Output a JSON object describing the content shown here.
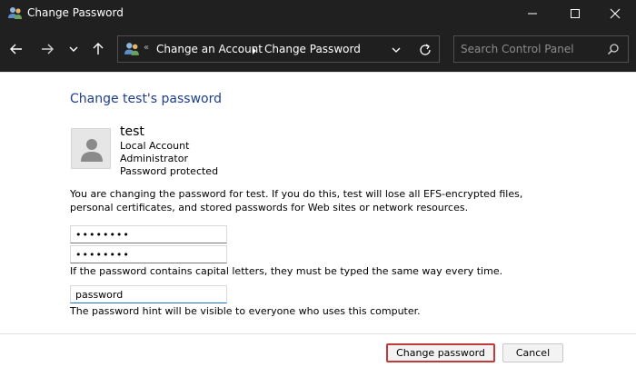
{
  "window": {
    "title": "Change Password"
  },
  "nav": {
    "breadcrumb_prefix": "«",
    "breadcrumb": [
      "Change an Account",
      "Change Password"
    ],
    "search_placeholder": "Search Control Panel"
  },
  "page": {
    "title": "Change test's password",
    "user": {
      "name": "test",
      "lines": [
        "Local Account",
        "Administrator",
        "Password protected"
      ]
    },
    "warning": "You are changing the password for test.  If you do this, test will lose all EFS-encrypted files, personal certificates, and stored passwords for Web sites or network resources.",
    "new_password_value": "••••••••",
    "confirm_password_value": "••••••••",
    "caps_note": "If the password contains capital letters, they must be typed the same way every time.",
    "hint_value": "password",
    "hint_note": "The password hint will be visible to everyone who uses this computer."
  },
  "buttons": {
    "change": "Change password",
    "cancel": "Cancel"
  },
  "colors": {
    "titlebar": "#202020",
    "title_blue": "#1e3f8a",
    "primary_border": "#c23a3a"
  }
}
